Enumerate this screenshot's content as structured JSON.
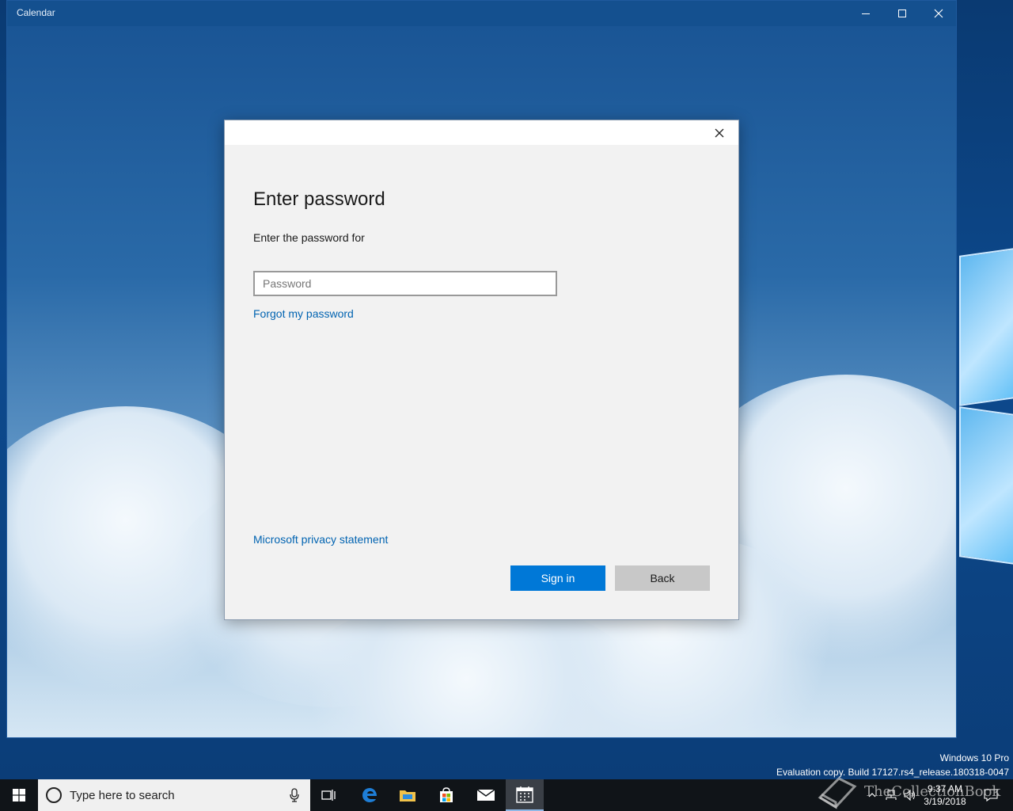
{
  "window": {
    "title": "Calendar"
  },
  "dialog": {
    "heading": "Enter password",
    "subtext": "Enter the password for",
    "password_placeholder": "Password",
    "forgot_link": "Forgot my password",
    "privacy_link": "Microsoft privacy statement",
    "signin_label": "Sign in",
    "back_label": "Back"
  },
  "desktop": {
    "edition": "Windows 10 Pro",
    "build": "Evaluation copy. Build 17127.rs4_release.180318-0047"
  },
  "taskbar": {
    "search_placeholder": "Type here to search",
    "pinned": [
      "task-view-icon",
      "edge-icon",
      "file-explorer-icon",
      "store-icon",
      "mail-icon",
      "calendar-icon"
    ],
    "active_app": "calendar-icon",
    "time": "9:37 AM",
    "date": "3/19/2018"
  },
  "watermark": {
    "text": "TheCollectionBook"
  },
  "colors": {
    "accent": "#0078d7",
    "link": "#0063b1",
    "titlebar": "#14508f",
    "taskbar": "#101418"
  }
}
